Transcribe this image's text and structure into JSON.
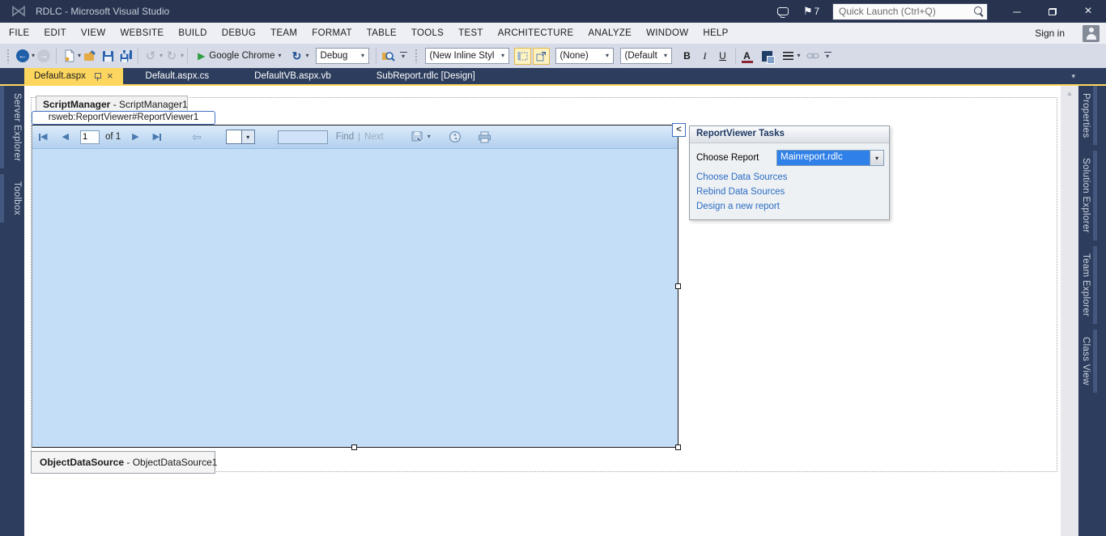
{
  "title_bar": {
    "title": "RDLC - Microsoft Visual Studio",
    "notification_count": "7",
    "quick_launch_placeholder": "Quick Launch (Ctrl+Q)"
  },
  "menu_bar": {
    "items": [
      "FILE",
      "EDIT",
      "VIEW",
      "WEBSITE",
      "BUILD",
      "DEBUG",
      "TEAM",
      "FORMAT",
      "TABLE",
      "TOOLS",
      "TEST",
      "ARCHITECTURE",
      "ANALYZE",
      "WINDOW",
      "HELP"
    ],
    "sign_in_label": "Sign in"
  },
  "toolbar": {
    "browse_target": "Google Chrome",
    "solution_config": "Debug",
    "style_combo": "(New Inline Style",
    "target_rule_combo": "(None)",
    "font_combo": "(Default",
    "bold_label": "B",
    "italic_label": "I",
    "underline_label": "U",
    "foreground_label": "A"
  },
  "document_tabs": [
    {
      "label": "Default.aspx",
      "active": true
    },
    {
      "label": "Default.aspx.cs",
      "active": false
    },
    {
      "label": "DefaultVB.aspx.vb",
      "active": false
    },
    {
      "label": "SubReport.rdlc [Design]",
      "active": false
    }
  ],
  "left_rail": {
    "tabs": [
      "Server Explorer",
      "Toolbox"
    ]
  },
  "right_rail": {
    "tabs": [
      "Properties",
      "Solution Explorer",
      "Team Explorer",
      "Class View"
    ]
  },
  "designer": {
    "script_manager": {
      "name": "ScriptManager",
      "suffix": " - ScriptManager1"
    },
    "selection_tooltip": "rsweb:ReportViewer#ReportViewer1",
    "smart_tag_glyph": "<",
    "rv_toolbar": {
      "page": "1",
      "of_label": "of 1",
      "find_label": "Find",
      "separator": "|",
      "next_label": "Next"
    },
    "object_data_source": {
      "name": "ObjectDataSource",
      "suffix": " - ObjectDataSource1"
    }
  },
  "tasks_panel": {
    "title": "ReportViewer Tasks",
    "choose_report_label": "Choose Report",
    "selected_report": "Mainreport.rdlc",
    "links": [
      "Choose Data Sources",
      "Rebind Data Sources",
      "Design a new report"
    ]
  },
  "icons": {
    "vs_logo": "⋈",
    "flag": "⚑",
    "minimize": "─",
    "close": "×",
    "caret_down": "▾",
    "back_arrow": "←",
    "forward_arrow": "→",
    "undo": "↺",
    "redo": "↻",
    "play": "▶",
    "refresh": "↻",
    "prev": "◀",
    "next": "▶",
    "parent_back": "⇦",
    "scroll_up": "▲"
  },
  "colors": {
    "chrome_dark": "#2c3d5d",
    "active_tab_gold": "#fcd65e",
    "report_body_blue": "#c5def8",
    "selection_blue": "#2f80e8",
    "link_blue": "#2a6cc4"
  }
}
